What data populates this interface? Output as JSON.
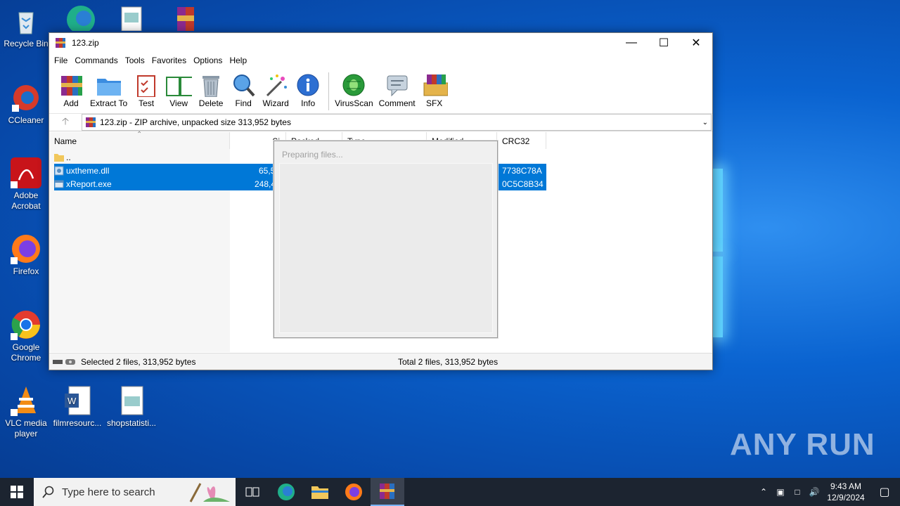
{
  "desktop": {
    "icons": [
      {
        "label": "Recycle Bin"
      },
      {
        "label": "CCleaner"
      },
      {
        "label": "Adobe Acrobat"
      },
      {
        "label": "Firefox"
      },
      {
        "label": "Google Chrome"
      },
      {
        "label": "VLC media player"
      },
      {
        "label": "filmresourc..."
      },
      {
        "label": "shopstatisti..."
      }
    ],
    "watermark": "ANY RUN"
  },
  "window": {
    "title": "123.zip",
    "menu": [
      "File",
      "Commands",
      "Tools",
      "Favorites",
      "Options",
      "Help"
    ],
    "toolbar": [
      "Add",
      "Extract To",
      "Test",
      "View",
      "Delete",
      "Find",
      "Wizard",
      "Info",
      "VirusScan",
      "Comment",
      "SFX"
    ],
    "address": "123.zip - ZIP archive, unpacked size 313,952 bytes",
    "columns": {
      "name": "Name",
      "size": "Si",
      "packed": "Packed",
      "type": "Type",
      "modified": "Modified",
      "crc": "CRC32"
    },
    "files": [
      {
        "name": "..",
        "size": "",
        "crc": ""
      },
      {
        "name": "uxtheme.dll",
        "size": "65,5",
        "crc": "7738C78A"
      },
      {
        "name": "xReport.exe",
        "size": "248,4",
        "crc": "0C5C8B34"
      }
    ],
    "status_left": "Selected 2 files, 313,952 bytes",
    "status_right": "Total 2 files, 313,952 bytes"
  },
  "dialog": {
    "text": "Preparing files..."
  },
  "taskbar": {
    "search_placeholder": "Type here to search",
    "time": "9:43 AM",
    "date": "12/9/2024"
  }
}
